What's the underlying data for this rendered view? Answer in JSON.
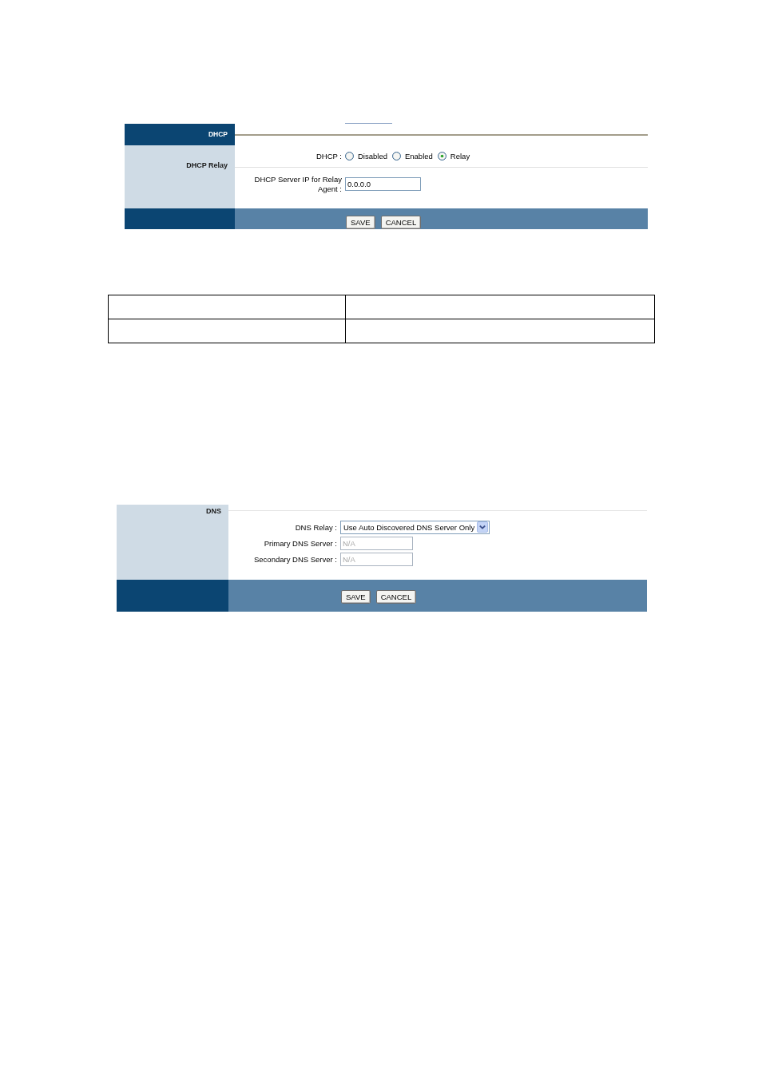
{
  "blocks": [
    {
      "kind": "dhcp",
      "header": "DHCP",
      "section": "DHCP Relay",
      "rows": [
        {
          "kind": "radio",
          "label": "DHCP :",
          "options": [
            {
              "label": "Disabled",
              "selected": false
            },
            {
              "label": "Enabled",
              "selected": false
            },
            {
              "label": "Relay",
              "selected": true
            }
          ]
        },
        {
          "kind": "text",
          "label": "DHCP Server IP for Relay Agent :",
          "value": "0.0.0.0",
          "disabled": false
        }
      ],
      "buttons": [
        "SAVE",
        "CANCEL"
      ]
    },
    {
      "kind": "empty_table"
    },
    {
      "kind": "dns",
      "section": "DNS",
      "rows": [
        {
          "kind": "select",
          "label": "DNS Relay :",
          "value": "Use Auto Discovered DNS Server Only"
        },
        {
          "kind": "text",
          "label": "Primary DNS Server :",
          "value": "N/A",
          "disabled": true
        },
        {
          "kind": "text",
          "label": "Secondary DNS Server :",
          "value": "N/A",
          "disabled": true
        }
      ],
      "buttons": [
        "SAVE",
        "CANCEL"
      ]
    }
  ]
}
